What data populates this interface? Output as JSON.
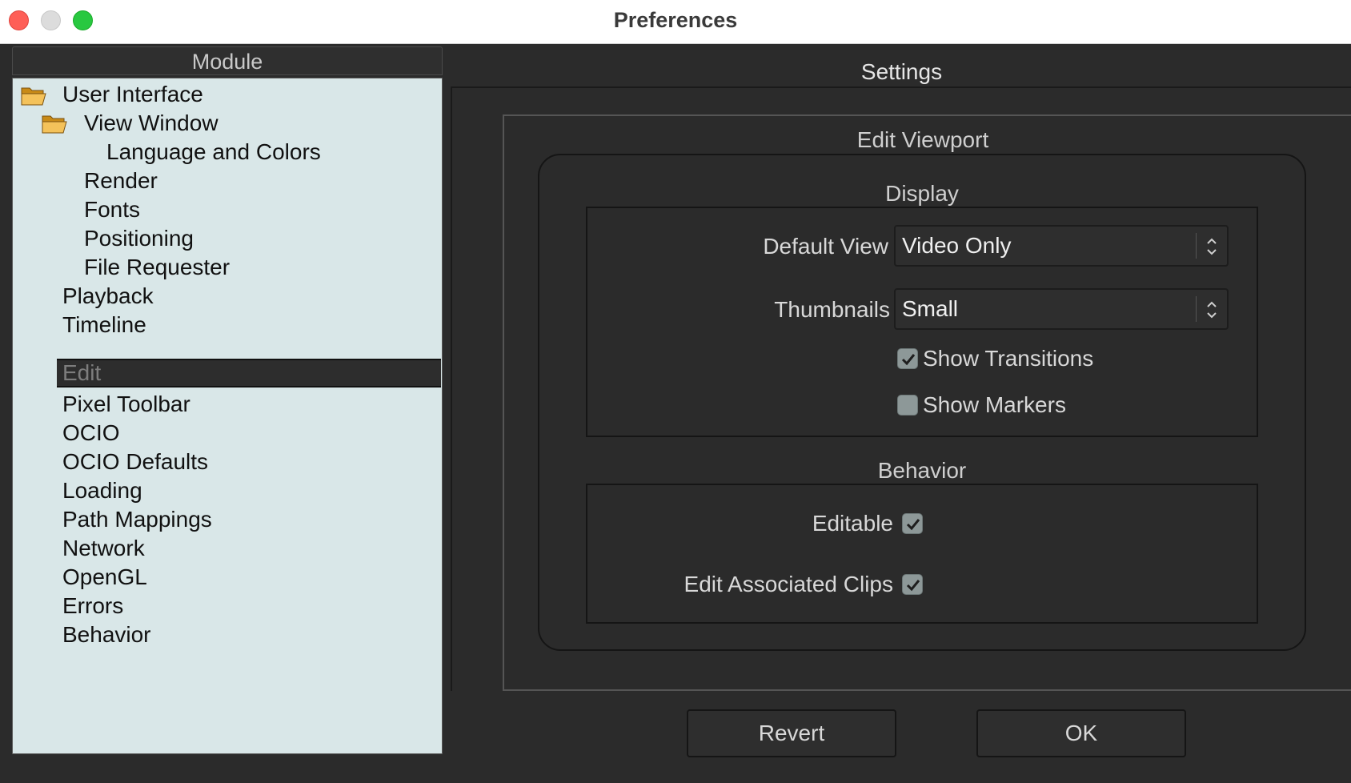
{
  "window": {
    "title": "Preferences"
  },
  "module_panel": {
    "header": "Module",
    "items": [
      {
        "label": "User Interface",
        "icon": "folder-open-icon"
      },
      {
        "label": "View Window",
        "icon": "folder-open-icon"
      },
      {
        "label": "Language and Colors"
      },
      {
        "label": "Render"
      },
      {
        "label": "Fonts"
      },
      {
        "label": "Positioning"
      },
      {
        "label": "File Requester"
      },
      {
        "label": "Playback"
      },
      {
        "label": "Timeline"
      },
      {
        "label": "Edit",
        "selected": true
      },
      {
        "label": "Pixel Toolbar"
      },
      {
        "label": "OCIO"
      },
      {
        "label": "OCIO Defaults"
      },
      {
        "label": "Loading"
      },
      {
        "label": "Path Mappings"
      },
      {
        "label": "Network"
      },
      {
        "label": "OpenGL"
      },
      {
        "label": "Errors"
      },
      {
        "label": "Behavior"
      }
    ]
  },
  "settings": {
    "title": "Settings",
    "page_title": "Edit Viewport",
    "display": {
      "title": "Display",
      "default_view_label": "Default View",
      "default_view_value": "Video Only",
      "thumbnails_label": "Thumbnails",
      "thumbnails_value": "Small",
      "show_transitions_label": "Show Transitions",
      "show_transitions_checked": true,
      "show_markers_label": "Show Markers",
      "show_markers_checked": false
    },
    "behavior": {
      "title": "Behavior",
      "editable_label": "Editable",
      "editable_checked": true,
      "edit_associated_label": "Edit Associated Clips",
      "edit_associated_checked": true
    }
  },
  "buttons": {
    "revert": "Revert",
    "ok": "OK"
  },
  "colors": {
    "window_bg": "#2b2b2b",
    "tree_bg": "#d9e7e8",
    "selected_bg": "#2d2d2d"
  }
}
